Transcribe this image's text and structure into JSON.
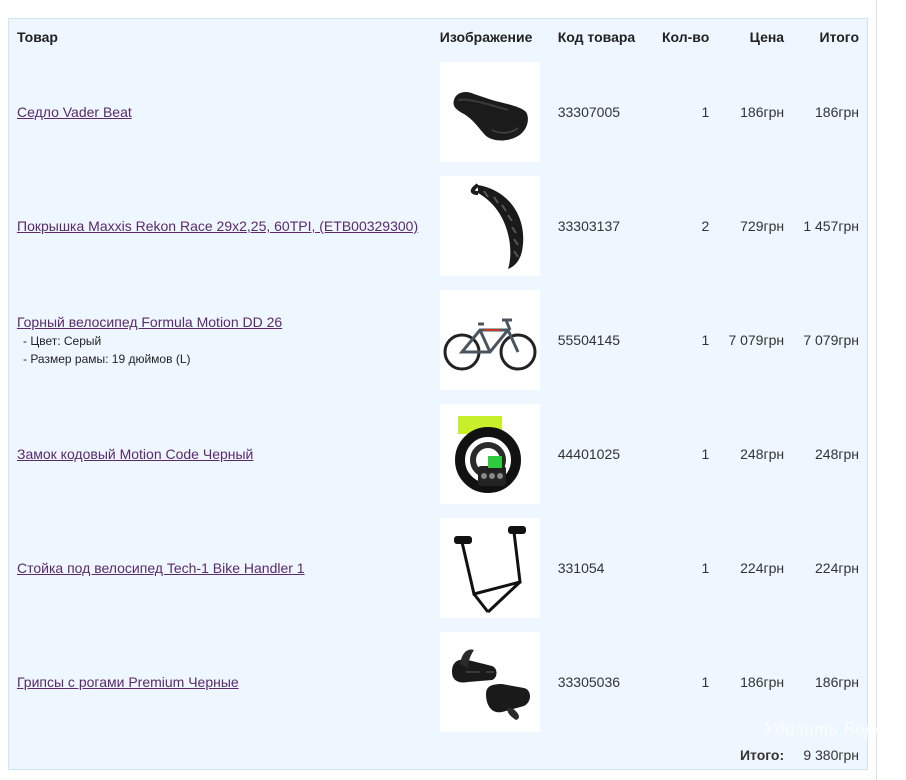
{
  "columns": {
    "product": "Товар",
    "image": "Изображение",
    "code": "Код товара",
    "qty": "Кол-во",
    "price": "Цена",
    "total": "Итого"
  },
  "items": [
    {
      "name": "Седло Vader Beat",
      "code": "33307005",
      "qty": "1",
      "price": "186грн",
      "total": "186грн",
      "image_icon": "saddle-icon"
    },
    {
      "name": "Покрышка Maxxis Rekon Race 29x2,25, 60TPI, (ETB00329300)",
      "code": "33303137",
      "qty": "2",
      "price": "729грн",
      "total": "1 457грн",
      "image_icon": "tire-icon"
    },
    {
      "name": "Горный велосипед Formula Motion DD 26",
      "options": [
        "- Цвет: Серый",
        "- Размер рамы: 19 дюймов (L)"
      ],
      "code": "55504145",
      "qty": "1",
      "price": "7 079грн",
      "total": "7 079грн",
      "image_icon": "bicycle-icon"
    },
    {
      "name": "Замок кодовый Motion Code Черный",
      "code": "44401025",
      "qty": "1",
      "price": "248грн",
      "total": "248грн",
      "image_icon": "cable-lock-icon"
    },
    {
      "name": "Стойка под велосипед Tech-1 Bike Handler 1",
      "code": "331054",
      "qty": "1",
      "price": "224грн",
      "total": "224грн",
      "image_icon": "bike-stand-icon"
    },
    {
      "name": "Грипсы с рогами Premium Черные",
      "code": "33305036",
      "qty": "1",
      "price": "186грн",
      "total": "186грн",
      "image_icon": "grips-icon"
    }
  ],
  "summary": {
    "label": "Итого:",
    "value": "9 380грн"
  },
  "watermark": "Удалить Ворд",
  "colors": {
    "frame_bg": "#eef7ff",
    "frame_border": "#cfe6f2",
    "link": "#5a2a6a"
  }
}
